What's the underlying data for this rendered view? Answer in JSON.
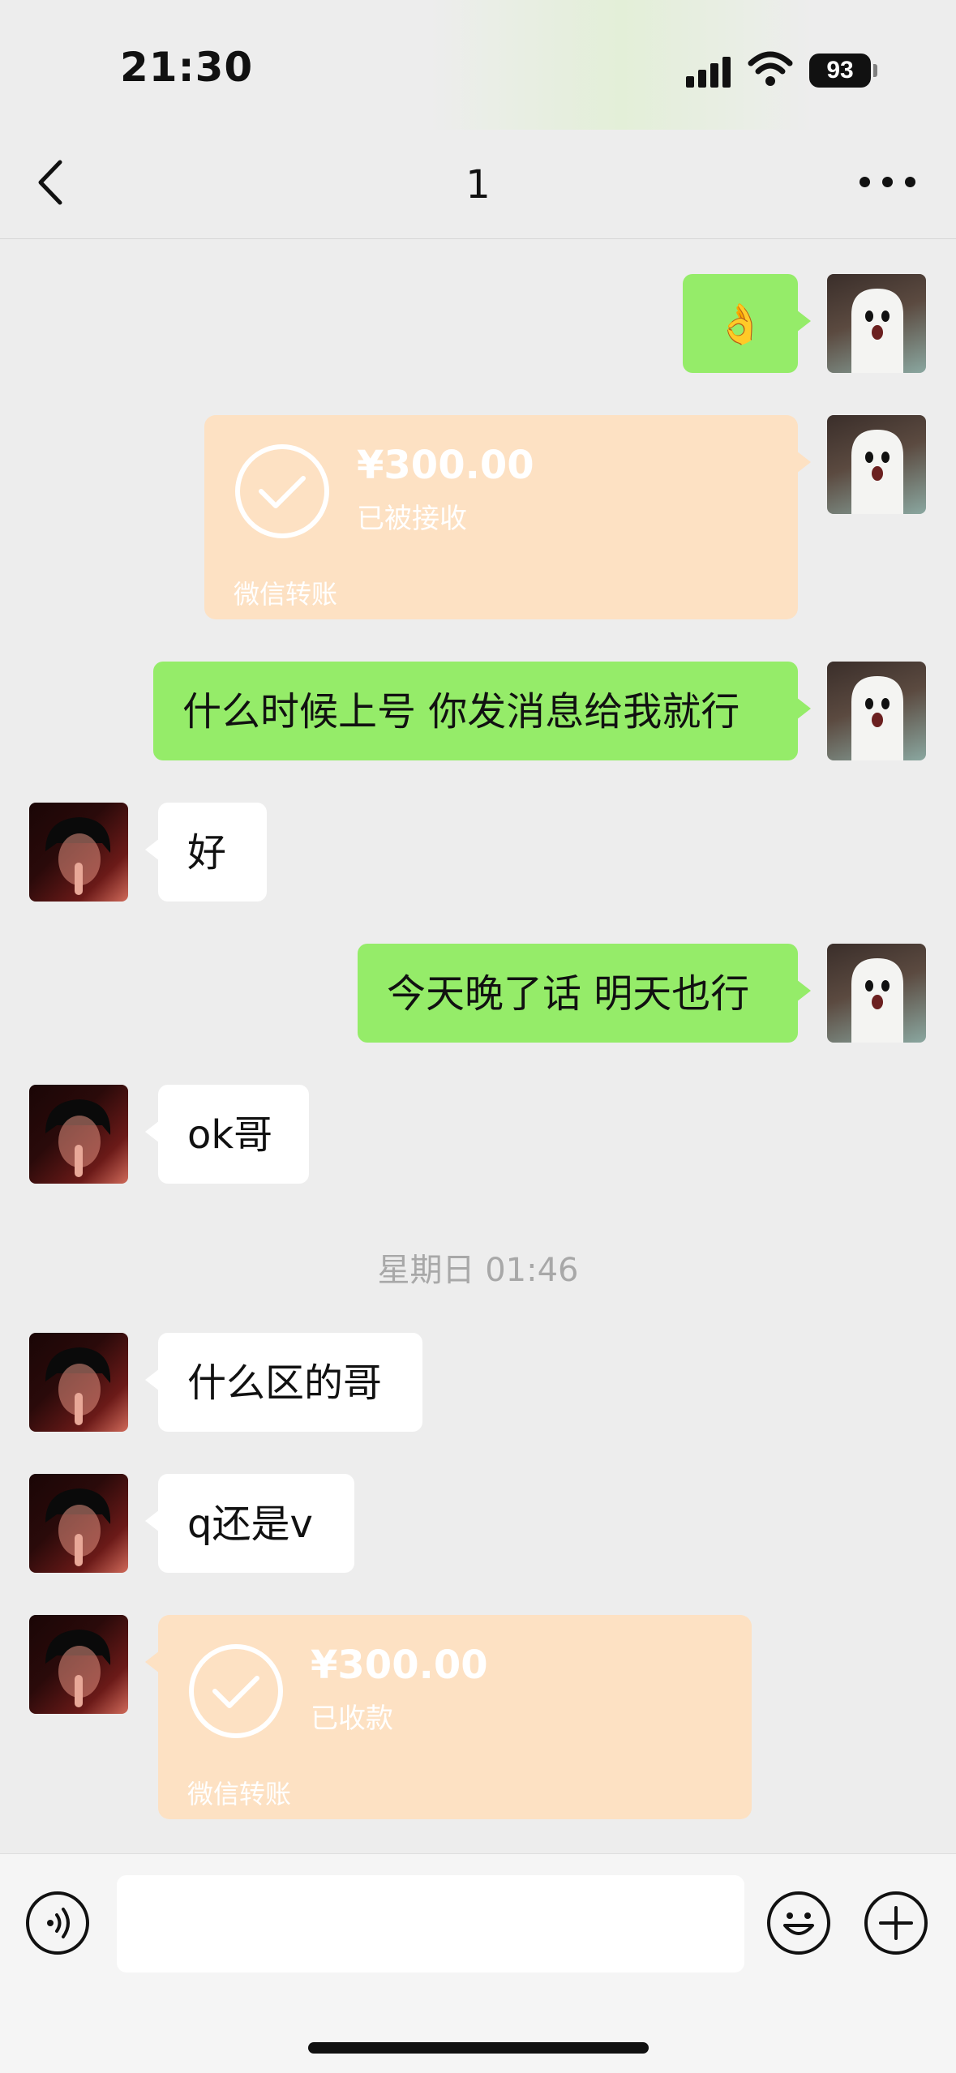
{
  "status_bar": {
    "time": "21:30",
    "battery": "93"
  },
  "nav": {
    "title": "1"
  },
  "messages": [
    {
      "sender": "me",
      "type": "text",
      "text": "👌"
    },
    {
      "sender": "me",
      "type": "transfer",
      "amount": "¥300.00",
      "status": "已被接收",
      "label": "微信转账"
    },
    {
      "sender": "me",
      "type": "text",
      "text": "什么时候上号 你发消息给我就行"
    },
    {
      "sender": "them",
      "type": "text",
      "text": "好"
    },
    {
      "sender": "me",
      "type": "text",
      "text": "今天晚了话 明天也行"
    },
    {
      "sender": "them",
      "type": "text",
      "text": "ok哥"
    },
    {
      "type": "time_divider",
      "text": "星期日 01:46"
    },
    {
      "sender": "them",
      "type": "text",
      "text": "什么区的哥"
    },
    {
      "sender": "them",
      "type": "text",
      "text": "q还是v"
    },
    {
      "sender": "them",
      "type": "transfer",
      "amount": "¥300.00",
      "status": "已收款",
      "label": "微信转账"
    }
  ],
  "input_bar": {
    "input_value": ""
  },
  "colors": {
    "my_bubble": "#95ec69",
    "their_bubble": "#ffffff",
    "transfer_card": "#fde1c3",
    "background": "#ededed"
  },
  "icons": [
    "back-icon",
    "more-icon",
    "voice-icon",
    "emoji-icon",
    "plus-icon",
    "check-icon",
    "signal-icon",
    "wifi-icon"
  ]
}
